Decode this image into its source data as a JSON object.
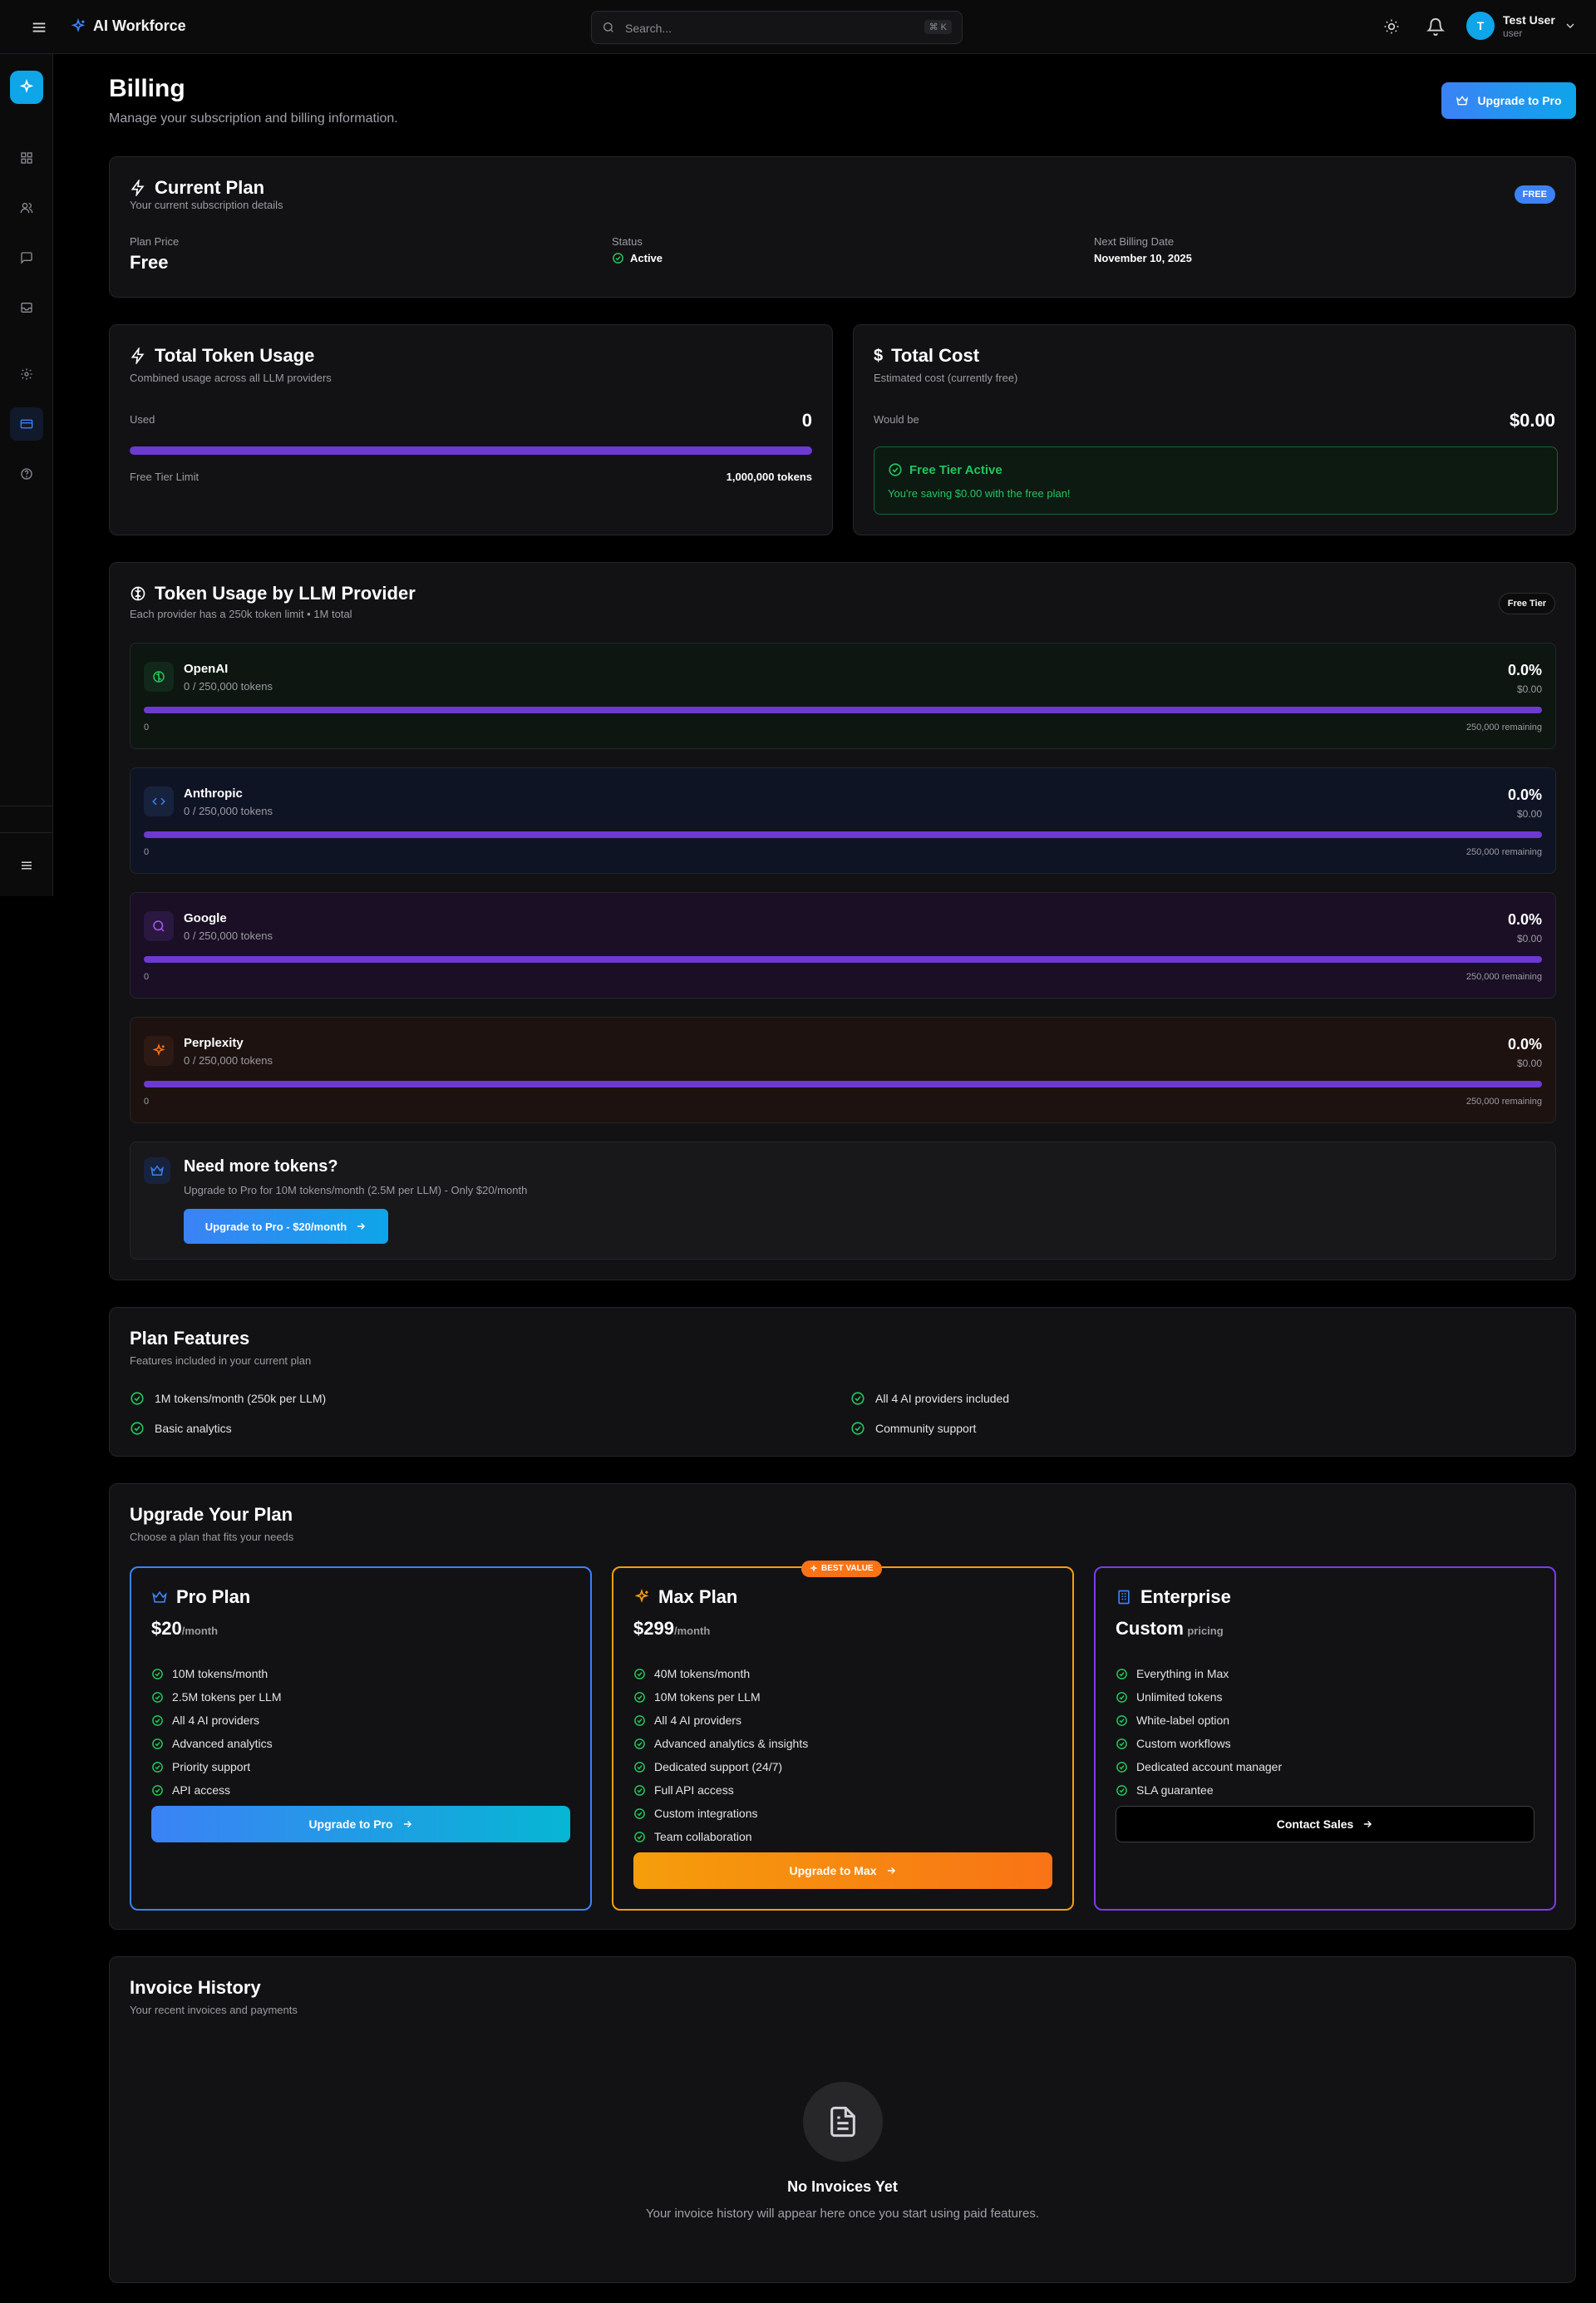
{
  "topbar": {
    "brand": "AI Workforce",
    "search_placeholder": "Search...",
    "search_shortcut": "⌘ K",
    "user": {
      "initial": "T",
      "name": "Test User",
      "role": "user"
    }
  },
  "page": {
    "title": "Billing",
    "subtitle": "Manage your subscription and billing information.",
    "upgrade_button": "Upgrade to Pro"
  },
  "current_plan": {
    "title": "Current Plan",
    "subtitle": "Your current subscription details",
    "badge": "FREE",
    "price_label": "Plan Price",
    "price_value": "Free",
    "status_label": "Status",
    "status_value": "Active",
    "billing_label": "Next Billing Date",
    "billing_value": "November 10, 2025"
  },
  "token_usage": {
    "title": "Total Token Usage",
    "subtitle": "Combined usage across all LLM providers",
    "used_label": "Used",
    "used_value": "0",
    "limit_label": "Free Tier Limit",
    "limit_value": "1,000,000 tokens",
    "usage_fraction": 0
  },
  "total_cost": {
    "title": "Total Cost",
    "subtitle": "Estimated cost (currently free)",
    "would_be_label": "Would be",
    "would_be_value": "$0.00",
    "free_tier_title": "Free Tier Active",
    "free_tier_text": "You're saving $0.00 with the free plan!"
  },
  "providers_section": {
    "title": "Token Usage by LLM Provider",
    "subtitle": "Each provider has a 250k token limit • 1M total",
    "chip": "Free Tier",
    "providers": [
      {
        "name": "OpenAI",
        "tokens": "0 / 250,000 tokens",
        "percent": "0.0%",
        "cost": "$0.00",
        "zero": "0",
        "remaining": "250,000 remaining",
        "color": "#22c55e"
      },
      {
        "name": "Anthropic",
        "tokens": "0 / 250,000 tokens",
        "percent": "0.0%",
        "cost": "$0.00",
        "zero": "0",
        "remaining": "250,000 remaining",
        "color": "#3b82f6"
      },
      {
        "name": "Google",
        "tokens": "0 / 250,000 tokens",
        "percent": "0.0%",
        "cost": "$0.00",
        "zero": "0",
        "remaining": "250,000 remaining",
        "color": "#a855f7"
      },
      {
        "name": "Perplexity",
        "tokens": "0 / 250,000 tokens",
        "percent": "0.0%",
        "cost": "$0.00",
        "zero": "0",
        "remaining": "250,000 remaining",
        "color": "#f97316"
      }
    ],
    "need_more": {
      "title": "Need more tokens?",
      "text": "Upgrade to Pro for 10M tokens/month (2.5M per LLM) - Only $20/month",
      "button": "Upgrade to Pro - $20/month"
    }
  },
  "features": {
    "title": "Plan Features",
    "subtitle": "Features included in your current plan",
    "items": [
      "1M tokens/month (250k per LLM)",
      "All 4 AI providers included",
      "Basic analytics",
      "Community support"
    ]
  },
  "upgrade": {
    "title": "Upgrade Your Plan",
    "subtitle": "Choose a plan that fits your needs",
    "plans": [
      {
        "name": "Pro Plan",
        "price": "$20",
        "period": "/month",
        "features": [
          "10M tokens/month",
          "2.5M tokens per LLM",
          "All 4 AI providers",
          "Advanced analytics",
          "Priority support",
          "API access"
        ],
        "button": "Upgrade to Pro"
      },
      {
        "name": "Max Plan",
        "badge": "BEST VALUE",
        "price": "$299",
        "period": "/month",
        "features": [
          "40M tokens/month",
          "10M tokens per LLM",
          "All 4 AI providers",
          "Advanced analytics & insights",
          "Dedicated support (24/7)",
          "Full API access",
          "Custom integrations",
          "Team collaboration"
        ],
        "button": "Upgrade to Max"
      },
      {
        "name": "Enterprise",
        "price": "Custom",
        "period": "pricing",
        "features": [
          "Everything in Max",
          "Unlimited tokens",
          "White-label option",
          "Custom workflows",
          "Dedicated account manager",
          "SLA guarantee"
        ],
        "button": "Contact Sales"
      }
    ]
  },
  "invoices": {
    "title": "Invoice History",
    "subtitle": "Your recent invoices and payments",
    "empty_title": "No Invoices Yet",
    "empty_text": "Your invoice history will appear here once you start using paid features."
  },
  "colors": {
    "accent": "#3b82f6",
    "progress": "#6d3ad1",
    "success": "#22c55e",
    "max": "#f59e0b",
    "enterprise": "#7c3aed"
  }
}
